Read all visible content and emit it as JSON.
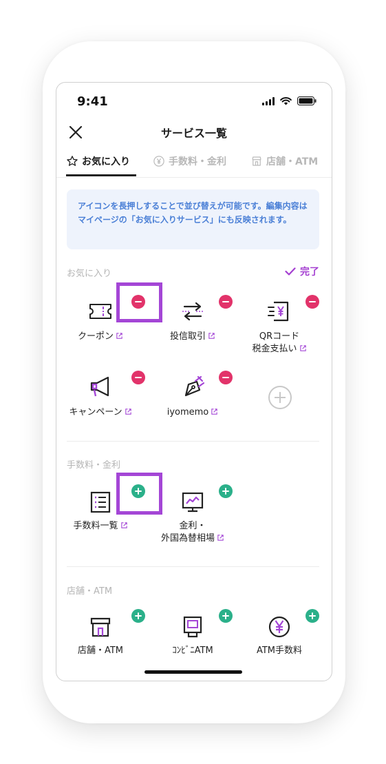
{
  "status": {
    "time": "9:41"
  },
  "header": {
    "title": "サービス一覧"
  },
  "tabs": [
    {
      "label": "お気に入り",
      "icon": "star-icon",
      "active": true
    },
    {
      "label": "手数料・金利",
      "icon": "yen-circle-icon",
      "active": false
    },
    {
      "label": "店舗・ATM",
      "icon": "store-icon",
      "active": false
    }
  ],
  "info": {
    "text": "アイコンを長押しすることで並び替えが可能です。編集内容はマイページの「お気に入りサービス」にも反映されます。"
  },
  "favorites": {
    "title": "お気に入り",
    "done_label": "完了",
    "items": [
      {
        "label": "クーポン",
        "icon": "coupon-ticket-icon",
        "action": "remove"
      },
      {
        "label": "投信取引",
        "icon": "exchange-arrows-icon",
        "action": "remove"
      },
      {
        "label": "QRコード",
        "label2": "税金支払い",
        "icon": "qr-yen-pay-icon",
        "action": "remove"
      },
      {
        "label": "キャンペーン",
        "icon": "megaphone-icon",
        "action": "remove"
      },
      {
        "label": "iyomemo",
        "icon": "pen-nib-icon",
        "action": "remove"
      }
    ]
  },
  "fees": {
    "title": "手数料・金利",
    "items": [
      {
        "label": "手数料一覧",
        "icon": "list-document-icon",
        "action": "add"
      },
      {
        "label": "金利・",
        "label2": "外国為替相場",
        "icon": "chart-monitor-icon",
        "action": "add"
      }
    ]
  },
  "stores": {
    "title": "店舗・ATM",
    "items": [
      {
        "label": "店舗・ATM",
        "icon": "storefront-icon",
        "action": "add"
      },
      {
        "label": "ｺﾝﾋﾞﾆATM",
        "icon": "atm-machine-icon",
        "action": "add"
      },
      {
        "label": "ATM手数料",
        "icon": "yen-coin-icon",
        "action": "add"
      }
    ]
  },
  "colors": {
    "accent_purple": "#a446d6",
    "remove_red": "#e2336a",
    "add_green": "#2bb08a",
    "info_blue": "#4a7fd6",
    "info_bg": "#eef3fc"
  }
}
